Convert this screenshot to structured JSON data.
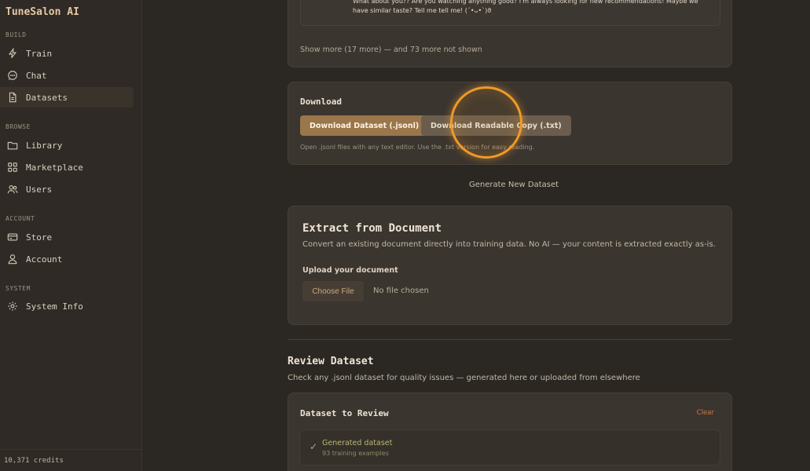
{
  "app": {
    "brand": "TuneSalon AI",
    "credits": "10,371 credits"
  },
  "sidebar": {
    "sections": [
      {
        "label": "BUILD",
        "items": [
          {
            "label": "Train",
            "icon": "bolt-icon"
          },
          {
            "label": "Chat",
            "icon": "chat-bubble-icon"
          },
          {
            "label": "Datasets",
            "icon": "document-icon",
            "active": true
          }
        ]
      },
      {
        "label": "BROWSE",
        "items": [
          {
            "label": "Library",
            "icon": "folder-icon"
          },
          {
            "label": "Marketplace",
            "icon": "grid-icon"
          },
          {
            "label": "Users",
            "icon": "users-icon"
          }
        ]
      },
      {
        "label": "ACCOUNT",
        "items": [
          {
            "label": "Store",
            "icon": "card-icon"
          },
          {
            "label": "Account",
            "icon": "person-icon"
          }
        ]
      },
      {
        "label": "SYSTEM",
        "items": [
          {
            "label": "System Info",
            "icon": "gear-icon"
          }
        ]
      }
    ]
  },
  "preview": {
    "message": "What about you?? Are you watching anything good? I'm always looking for new recommendations! Maybe we have similar taste? Tell me tell me! (´•ᴗ•`)ϑ",
    "show_more": "Show more (17 more) — and 73 more not shown"
  },
  "download": {
    "title": "Download",
    "jsonl_button": "Download Dataset (.jsonl)",
    "txt_button": "Download Readable Copy (.txt)",
    "hint": "Open .jsonl files with any text editor. Use the .txt version for easy reading."
  },
  "generate_new": "Generate New Dataset",
  "extract": {
    "title": "Extract from Document",
    "subtitle": "Convert an existing document directly into training data. No AI — your content is extracted exactly as-is.",
    "upload_label": "Upload your document",
    "choose_file": "Choose File",
    "no_file": "No file chosen"
  },
  "review": {
    "title": "Review Dataset",
    "subtitle": "Check any .jsonl dataset for quality issues — generated here or uploaded from elsewhere",
    "card_title": "Dataset to Review",
    "clear": "Clear",
    "generated_title": "Generated dataset",
    "generated_sub": "93 training examples"
  },
  "colors": {
    "accent": "#9a764b",
    "cursor": "#ef9a2a",
    "success": "#a8b06a"
  }
}
